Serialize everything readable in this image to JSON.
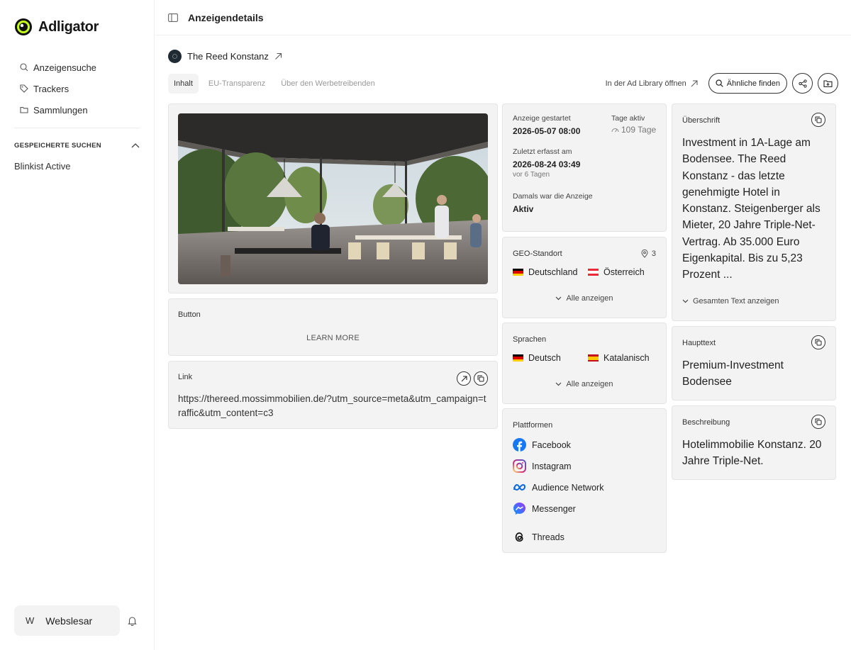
{
  "brand": {
    "name": "Adligator",
    "accent": "#c6ff1a"
  },
  "sidebar": {
    "nav": [
      {
        "label": "Anzeigensuche",
        "icon": "search-icon"
      },
      {
        "label": "Trackers",
        "icon": "tag-icon"
      },
      {
        "label": "Sammlungen",
        "icon": "folder-icon"
      }
    ],
    "saved_header": "GESPEICHERTE SUCHEN",
    "saved_items": [
      "Blinkist Active"
    ],
    "user": {
      "initial": "W",
      "name": "Webslesar"
    }
  },
  "topbar": {
    "title": "Anzeigendetails"
  },
  "advertiser": {
    "name": "The Reed Konstanz"
  },
  "tabs": [
    "Inhalt",
    "EU-Transparenz",
    "Über den Werbetreibenden"
  ],
  "actions": {
    "open_library": "In der Ad Library öffnen",
    "similar": "Ähnliche finden"
  },
  "button_card": {
    "label": "Button",
    "cta": "LEARN MORE"
  },
  "link_card": {
    "label": "Link",
    "url": "https://thereed.mossimmobilien.de/?utm_source=meta&utm_campaign=traffic&utm_content=c3"
  },
  "dates": {
    "started_label": "Anzeige gestartet",
    "started_value": "2026-05-07 08:00",
    "days_label": "Tage aktiv",
    "days_value": "109 Tage",
    "last_label": "Zuletzt erfasst am",
    "last_value": "2026-08-24 03:49",
    "last_sub": "vor 6 Tagen",
    "status_label": "Damals war die Anzeige",
    "status_value": "Aktiv"
  },
  "geo": {
    "label": "GEO-Standort",
    "count": "3",
    "items": [
      "Deutschland",
      "Österreich"
    ],
    "show_all": "Alle anzeigen"
  },
  "languages": {
    "label": "Sprachen",
    "items": [
      "Deutsch",
      "Katalanisch"
    ],
    "show_all": "Alle anzeigen"
  },
  "platforms": {
    "label": "Plattformen",
    "items": [
      "Facebook",
      "Instagram",
      "Audience Network",
      "Messenger",
      "Threads"
    ]
  },
  "headline": {
    "label": "Überschrift",
    "text": "Investment in 1A-Lage am Bodensee. The Reed Konstanz - das letzte genehmigte Hotel in Konstanz. Steigenberger als Mieter, 20 Jahre Triple-Net-Vertrag. Ab 35.000 Euro Eigenkapital. Bis zu 5,23 Prozent ...",
    "more": "Gesamten Text anzeigen"
  },
  "main_text": {
    "label": "Haupttext",
    "text": "Premium-Investment Bodensee"
  },
  "description": {
    "label": "Beschreibung",
    "text": "Hotelimmobilie Konstanz. 20 Jahre Triple-Net."
  }
}
